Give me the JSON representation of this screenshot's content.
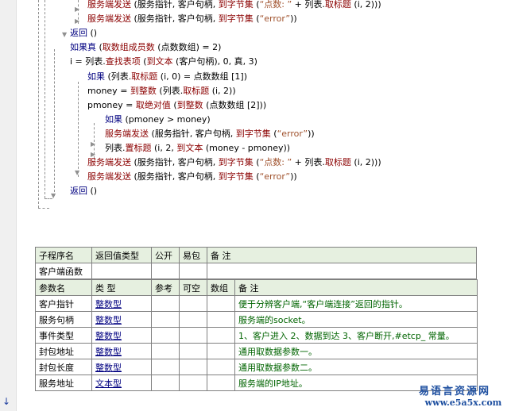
{
  "code_lines": [
    {
      "id": "l1",
      "parts": [
        {
          "c": "fn",
          "t": "服务端发送"
        },
        {
          "c": "",
          "t": " (服务指针, 客户句柄, "
        },
        {
          "c": "fn",
          "t": "到字节集"
        },
        {
          "c": "",
          "t": " ("
        },
        {
          "c": "str",
          "t": "“点数: ”"
        },
        {
          "c": "",
          "t": " + 列表."
        },
        {
          "c": "fn",
          "t": "取标题"
        },
        {
          "c": "",
          "t": " (i, 2)))"
        }
      ]
    },
    {
      "id": "l2",
      "parts": [
        {
          "c": "fn",
          "t": "服务端发送"
        },
        {
          "c": "",
          "t": " (服务指针, 客户句柄, "
        },
        {
          "c": "fn",
          "t": "到字节集"
        },
        {
          "c": "",
          "t": " ("
        },
        {
          "c": "str",
          "t": "“error”"
        },
        {
          "c": "",
          "t": "))"
        }
      ]
    },
    {
      "id": "l3",
      "parts": [
        {
          "c": "kw",
          "t": "返回"
        },
        {
          "c": "",
          "t": " ()"
        }
      ]
    },
    {
      "id": "l4",
      "parts": [
        {
          "c": "kw",
          "t": "如果真"
        },
        {
          "c": "",
          "t": " ("
        },
        {
          "c": "fn",
          "t": "取数组成员数"
        },
        {
          "c": "",
          "t": " (点数数组) = 2)"
        }
      ]
    },
    {
      "id": "l5",
      "parts": [
        {
          "c": "",
          "t": "i = 列表."
        },
        {
          "c": "fn",
          "t": "查找表项"
        },
        {
          "c": "",
          "t": " ("
        },
        {
          "c": "fn",
          "t": "到文本"
        },
        {
          "c": "",
          "t": " (客户句柄), 0, 真, 3)"
        }
      ]
    },
    {
      "id": "l6",
      "parts": [
        {
          "c": "kw",
          "t": "如果"
        },
        {
          "c": "",
          "t": " (列表."
        },
        {
          "c": "fn",
          "t": "取标题"
        },
        {
          "c": "",
          "t": " (i, 0) = 点数数组 [1])"
        }
      ]
    },
    {
      "id": "l7",
      "parts": [
        {
          "c": "",
          "t": "money = "
        },
        {
          "c": "fn",
          "t": "到整数"
        },
        {
          "c": "",
          "t": " (列表."
        },
        {
          "c": "fn",
          "t": "取标题"
        },
        {
          "c": "",
          "t": " (i, 2))"
        }
      ]
    },
    {
      "id": "l8",
      "parts": [
        {
          "c": "",
          "t": "pmoney = "
        },
        {
          "c": "fn",
          "t": "取绝对值"
        },
        {
          "c": "",
          "t": " ("
        },
        {
          "c": "fn",
          "t": "到整数"
        },
        {
          "c": "",
          "t": " (点数数组 [2]))"
        }
      ]
    },
    {
      "id": "l9",
      "parts": [
        {
          "c": "kw",
          "t": "如果"
        },
        {
          "c": "",
          "t": " (pmoney > money)"
        }
      ]
    },
    {
      "id": "l10",
      "parts": [
        {
          "c": "fn",
          "t": "服务端发送"
        },
        {
          "c": "",
          "t": " (服务指针, 客户句柄, "
        },
        {
          "c": "fn",
          "t": "到字节集"
        },
        {
          "c": "",
          "t": " ("
        },
        {
          "c": "str",
          "t": "“error”"
        },
        {
          "c": "",
          "t": "))"
        }
      ]
    },
    {
      "id": "l11",
      "parts": [
        {
          "c": "",
          "t": "列表."
        },
        {
          "c": "fn",
          "t": "置标题"
        },
        {
          "c": "",
          "t": " (i, 2, "
        },
        {
          "c": "fn",
          "t": "到文本"
        },
        {
          "c": "",
          "t": " (money - pmoney))"
        }
      ]
    },
    {
      "id": "l12",
      "parts": [
        {
          "c": "fn",
          "t": "服务端发送"
        },
        {
          "c": "",
          "t": " (服务指针, 客户句柄, "
        },
        {
          "c": "fn",
          "t": "到字节集"
        },
        {
          "c": "",
          "t": " ("
        },
        {
          "c": "str",
          "t": "“点数: ”"
        },
        {
          "c": "",
          "t": " + 列表."
        },
        {
          "c": "fn",
          "t": "取标题"
        },
        {
          "c": "",
          "t": " (i, 2)))"
        }
      ]
    },
    {
      "id": "l13",
      "parts": [
        {
          "c": "fn",
          "t": "服务端发送"
        },
        {
          "c": "",
          "t": " (服务指针, 客户句柄, "
        },
        {
          "c": "fn",
          "t": "到字节集"
        },
        {
          "c": "",
          "t": " ("
        },
        {
          "c": "str",
          "t": "“error”"
        },
        {
          "c": "",
          "t": "))"
        }
      ]
    },
    {
      "id": "l14",
      "parts": [
        {
          "c": "kw",
          "t": "返回"
        },
        {
          "c": "",
          "t": " ()"
        }
      ]
    }
  ],
  "sub_table": {
    "headers": [
      "子程序名",
      "返回值类型",
      "公开",
      "易包",
      "备 注"
    ],
    "row": [
      "客户端函数",
      "",
      "",
      "",
      ""
    ]
  },
  "param_table": {
    "headers": [
      "参数名",
      "类 型",
      "参考",
      "可空",
      "数组",
      "备 注"
    ],
    "rows": [
      [
        "客户指针",
        "整数型",
        "",
        "",
        "",
        "便于分辨客户端,“客户端连接”返回的指针。"
      ],
      [
        "服务句柄",
        "整数型",
        "",
        "",
        "",
        "服务端的socket。"
      ],
      [
        "事件类型",
        "整数型",
        "",
        "",
        "",
        "1、客户进入 2、数据到达 3、客户断开,#etcp_ 常量。"
      ],
      [
        "封包地址",
        "整数型",
        "",
        "",
        "",
        "通用取数据参数一。"
      ],
      [
        "封包长度",
        "整数型",
        "",
        "",
        "",
        "通用取数据参数二。"
      ],
      [
        "服务地址",
        "文本型",
        "",
        "",
        "",
        "服务端的IP地址。"
      ]
    ]
  },
  "watermark": {
    "top": "易语言资源网",
    "bottom": "www.e5a5x.com"
  }
}
